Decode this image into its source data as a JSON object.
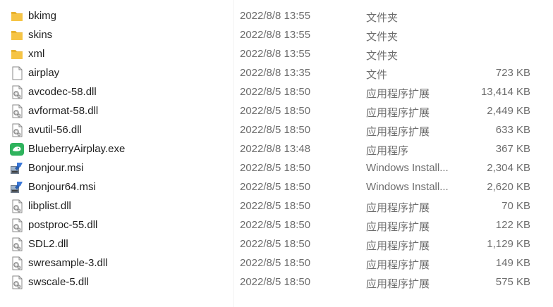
{
  "files": [
    {
      "name": "bkimg",
      "date": "2022/8/8 13:55",
      "type": "文件夹",
      "size": "",
      "icon": "folder-icon"
    },
    {
      "name": "skins",
      "date": "2022/8/8 13:55",
      "type": "文件夹",
      "size": "",
      "icon": "folder-icon"
    },
    {
      "name": "xml",
      "date": "2022/8/8 13:55",
      "type": "文件夹",
      "size": "",
      "icon": "folder-icon"
    },
    {
      "name": "airplay",
      "date": "2022/8/8 13:35",
      "type": "文件",
      "size": "723 KB",
      "icon": "file-icon"
    },
    {
      "name": "avcodec-58.dll",
      "date": "2022/8/5 18:50",
      "type": "应用程序扩展",
      "size": "13,414 KB",
      "icon": "dll-icon"
    },
    {
      "name": "avformat-58.dll",
      "date": "2022/8/5 18:50",
      "type": "应用程序扩展",
      "size": "2,449 KB",
      "icon": "dll-icon"
    },
    {
      "name": "avutil-56.dll",
      "date": "2022/8/5 18:50",
      "type": "应用程序扩展",
      "size": "633 KB",
      "icon": "dll-icon"
    },
    {
      "name": "BlueberryAirplay.exe",
      "date": "2022/8/8 13:48",
      "type": "应用程序",
      "size": "367 KB",
      "icon": "exe-icon"
    },
    {
      "name": "Bonjour.msi",
      "date": "2022/8/5 18:50",
      "type": "Windows Install...",
      "size": "2,304 KB",
      "icon": "msi-icon"
    },
    {
      "name": "Bonjour64.msi",
      "date": "2022/8/5 18:50",
      "type": "Windows Install...",
      "size": "2,620 KB",
      "icon": "msi-icon"
    },
    {
      "name": "libplist.dll",
      "date": "2022/8/5 18:50",
      "type": "应用程序扩展",
      "size": "70 KB",
      "icon": "dll-icon"
    },
    {
      "name": "postproc-55.dll",
      "date": "2022/8/5 18:50",
      "type": "应用程序扩展",
      "size": "122 KB",
      "icon": "dll-icon"
    },
    {
      "name": "SDL2.dll",
      "date": "2022/8/5 18:50",
      "type": "应用程序扩展",
      "size": "1,129 KB",
      "icon": "dll-icon"
    },
    {
      "name": "swresample-3.dll",
      "date": "2022/8/5 18:50",
      "type": "应用程序扩展",
      "size": "149 KB",
      "icon": "dll-icon"
    },
    {
      "name": "swscale-5.dll",
      "date": "2022/8/5 18:50",
      "type": "应用程序扩展",
      "size": "575 KB",
      "icon": "dll-icon"
    }
  ],
  "colors": {
    "folder": "#f6c445",
    "folder_dark": "#e8b12c",
    "text": "#1f1f1f",
    "meta": "#6d6d6d"
  }
}
